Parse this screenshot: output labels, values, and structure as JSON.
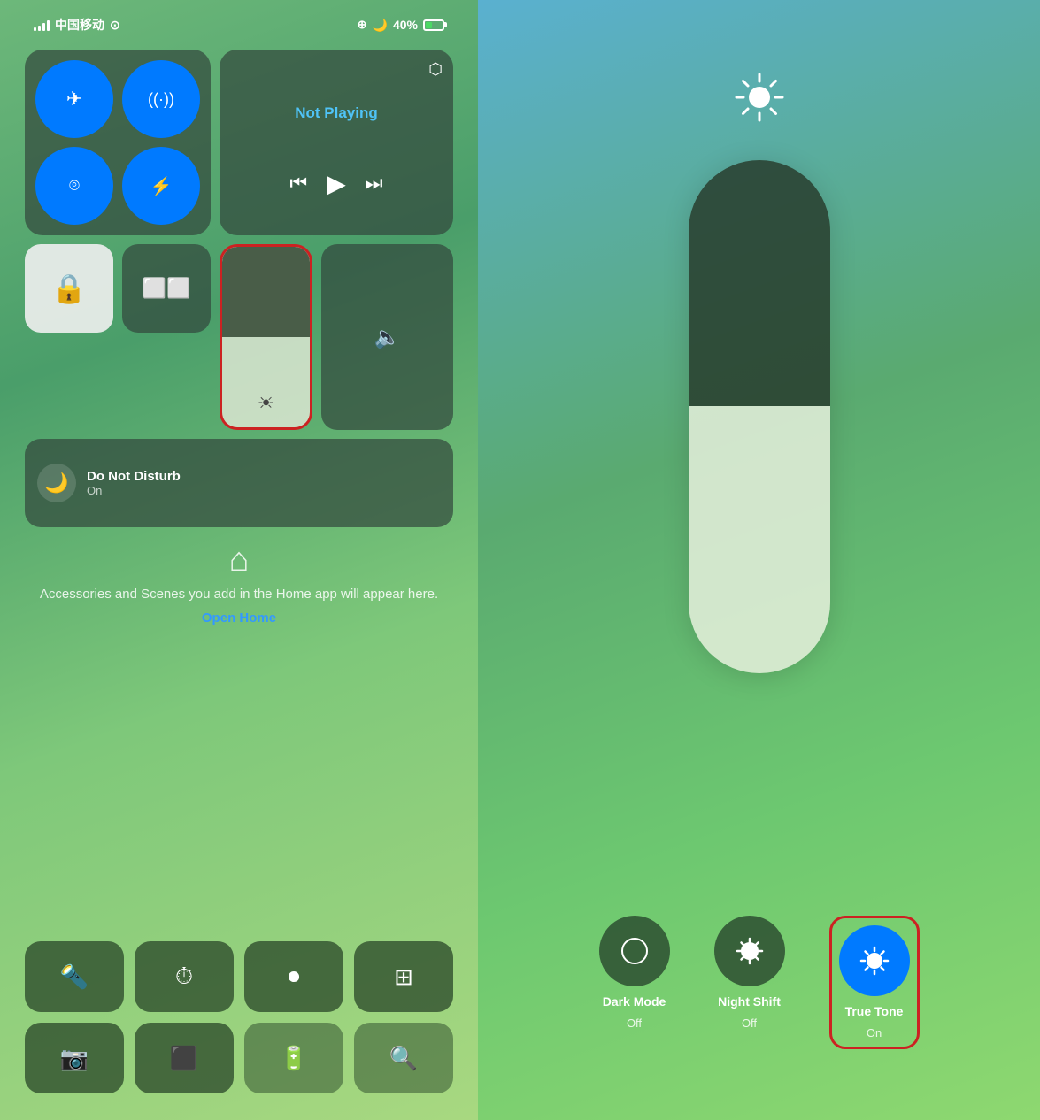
{
  "left": {
    "status": {
      "carrier": "中国移动",
      "battery_percent": "40%",
      "wifi": true,
      "moon": true
    },
    "toggles": [
      {
        "id": "airplane",
        "icon": "✈",
        "active": true
      },
      {
        "id": "cellular",
        "icon": "📡",
        "active": true
      },
      {
        "id": "wifi",
        "icon": "📶",
        "active": true
      },
      {
        "id": "bluetooth",
        "icon": "Ᵽ",
        "active": true
      }
    ],
    "media": {
      "label": "Not Playing",
      "airplay": "⬡"
    },
    "lock": {
      "icon": "🔒"
    },
    "mirror": {
      "icon": "⬜"
    },
    "brightness": {
      "level": 50
    },
    "volume": {
      "icon": "🔈"
    },
    "dnd": {
      "title": "Do Not Disturb",
      "status": "On"
    },
    "home": {
      "desc": "Accessories and Scenes you add in the Home app will appear here.",
      "open_label": "Open Home"
    },
    "toolbar": [
      [
        {
          "icon": "🔦",
          "dim": false
        },
        {
          "icon": "⏱",
          "dim": false
        },
        {
          "icon": "⏺",
          "dim": false
        },
        {
          "icon": "🔢",
          "dim": false
        }
      ],
      [
        {
          "icon": "📷",
          "dim": false
        },
        {
          "icon": "⬛",
          "dim": false
        },
        {
          "icon": "🔋",
          "dim": false
        },
        {
          "icon": "🔍",
          "dim": true
        }
      ]
    ]
  },
  "right": {
    "sun_icon": "☀",
    "pill": {
      "top_ratio": 48,
      "bottom_ratio": 52
    },
    "controls": [
      {
        "id": "dark-mode",
        "icon": "◑",
        "label": "Dark Mode",
        "sublabel": "Off",
        "active": false
      },
      {
        "id": "night-shift",
        "icon": "☀",
        "label": "Night Shift",
        "sublabel": "Off",
        "active": false
      },
      {
        "id": "true-tone",
        "icon": "☀",
        "label": "True Tone",
        "sublabel": "On",
        "active": true,
        "highlighted": true
      }
    ]
  }
}
